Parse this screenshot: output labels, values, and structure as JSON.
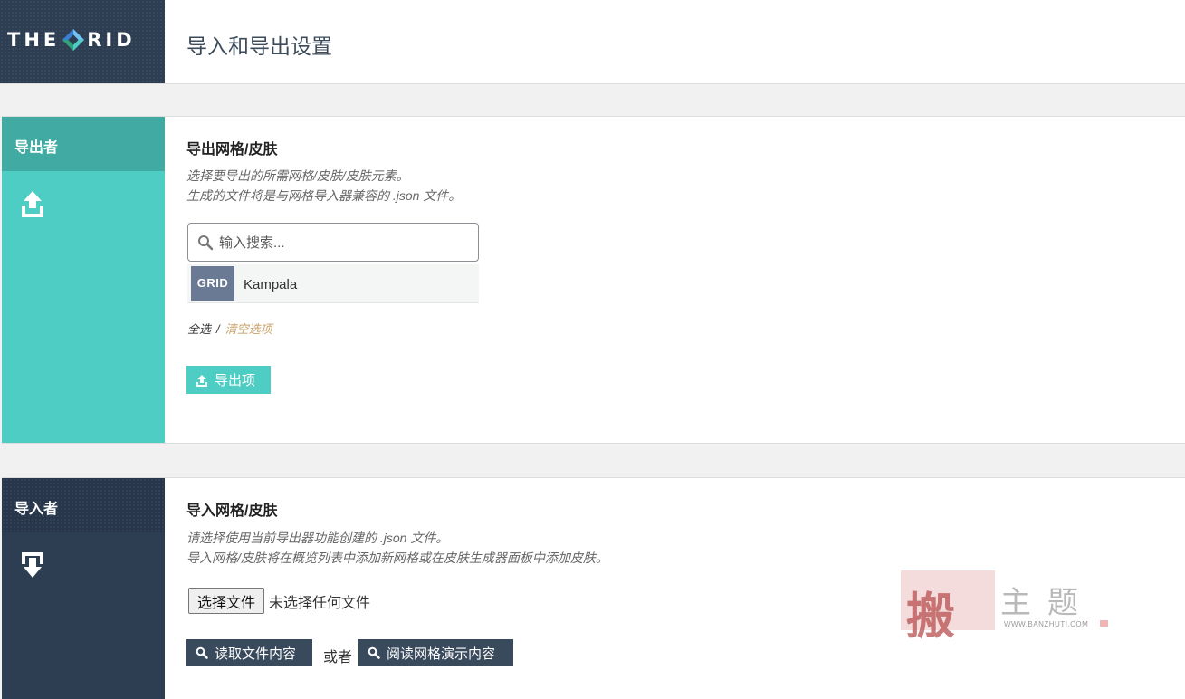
{
  "header": {
    "logo_text_left": "THE",
    "logo_text_right": "RID",
    "page_title": "导入和导出设置"
  },
  "exporter": {
    "side_label": "导出者",
    "side_icon": "upload-icon",
    "title": "导出网格/皮肤",
    "desc_line1": "选择要导出的所需网格/皮肤/皮肤元素。",
    "desc_line2": "生成的文件将是与网格导入器兼容的 .json 文件。",
    "search_placeholder": "输入搜索...",
    "items": [
      {
        "thumb_label": "GRID",
        "name": "Kampala"
      }
    ],
    "select_all": "全选",
    "separator": "/",
    "clear_selection": "清空选项",
    "export_button": "导出项"
  },
  "importer": {
    "side_label": "导入者",
    "side_icon": "download-icon",
    "title": "导入网格/皮肤",
    "desc_line1": "请选择使用当前导出器功能创建的 .json 文件。",
    "desc_line2": "导入网格/皮肤将在概览列表中添加新网格或在皮肤生成器面板中添加皮肤。",
    "file_button": "选择文件",
    "file_status": "未选择任何文件",
    "read_button": "读取文件内容",
    "or_text": "或者",
    "demo_button": "阅读网格演示内容"
  },
  "watermark": {
    "stamp_char": "搬",
    "text": "主题",
    "url": "WWW.BANZHUTI.COM"
  },
  "colors": {
    "accent_teal": "#4ecdc4",
    "dark_navy": "#2e3e52",
    "link_gold": "#c8a36a"
  }
}
